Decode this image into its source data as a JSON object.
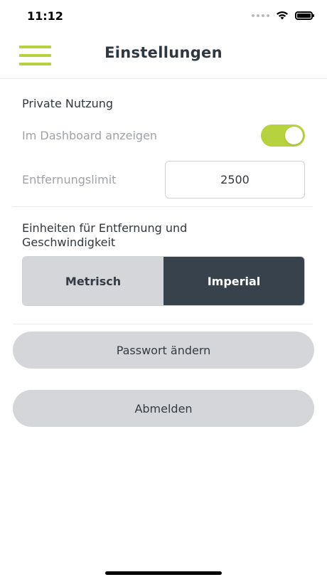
{
  "status_bar": {
    "time": "11:12"
  },
  "nav": {
    "title": "Einstellungen"
  },
  "private": {
    "section_title": "Private Nutzung",
    "dashboard_label": "Im Dashboard anzeigen",
    "dashboard_enabled": true,
    "limit_label": "Entfernungslimit",
    "limit_value": "2500"
  },
  "units": {
    "section_title": "Einheiten für Entfernung und Geschwindigkeit",
    "options": [
      "Metrisch",
      "Imperial"
    ],
    "selected": "Imperial"
  },
  "buttons": {
    "change_password": "Passwort ändern",
    "logout": "Abmelden"
  },
  "colors": {
    "accent": "#b6d23e",
    "dark": "#37424c",
    "button_bg": "#d4d6d9"
  }
}
